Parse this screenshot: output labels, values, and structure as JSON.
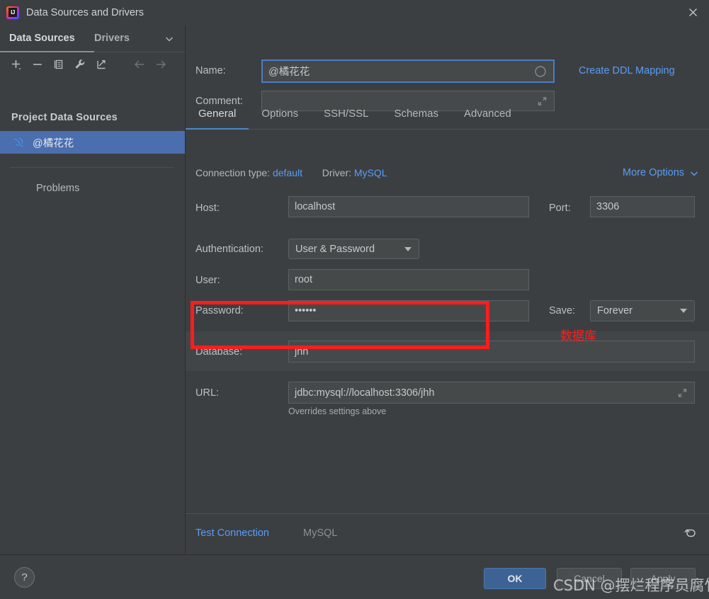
{
  "window": {
    "title": "Data Sources and Drivers",
    "app_icon": "intellij-idea-icon",
    "close_label": "✕"
  },
  "sidebar": {
    "tabs": [
      {
        "label": "Data Sources",
        "active": true
      },
      {
        "label": "Drivers",
        "active": false
      }
    ],
    "chevron": "chevron-down-icon",
    "toolbar": [
      {
        "name": "add-data-source-button",
        "icon": "plus-icon"
      },
      {
        "name": "remove-data-source-button",
        "icon": "minus-icon"
      },
      {
        "name": "duplicate-data-source-button",
        "icon": "copy-icon"
      },
      {
        "name": "driver-properties-button",
        "icon": "wrench-icon"
      },
      {
        "name": "share-data-source-button",
        "icon": "export-arrow-icon"
      },
      {
        "name": "navigate-back-button",
        "icon": "arrow-left-icon"
      },
      {
        "name": "navigate-forward-button",
        "icon": "arrow-right-icon"
      }
    ],
    "section_title": "Project Data Sources",
    "items": [
      {
        "label": "@橘花花",
        "icon": "mysql-dolphin-icon",
        "selected": true
      }
    ],
    "problems_label": "Problems"
  },
  "header": {
    "name_label": "Name:",
    "name_value": "@橘花花",
    "name_adorn_icon": "circle-icon",
    "comment_label": "Comment:",
    "comment_value": "",
    "comment_placeholder": "",
    "comment_expand_icon": "expand-icon",
    "create_ddl_mapping_label": "Create DDL Mapping"
  },
  "tabs": [
    {
      "label": "General",
      "active": true
    },
    {
      "label": "Options",
      "active": false
    },
    {
      "label": "SSH/SSL",
      "active": false
    },
    {
      "label": "Schemas",
      "active": false
    },
    {
      "label": "Advanced",
      "active": false
    }
  ],
  "general": {
    "connection_type_label": "Connection type:",
    "connection_type_value": "default",
    "driver_label": "Driver:",
    "driver_value": "MySQL",
    "more_options_label": "More Options",
    "more_options_icon": "chevron-down-icon",
    "host_label": "Host:",
    "host_value": "localhost",
    "port_label": "Port:",
    "port_value": "3306",
    "authentication_label": "Authentication:",
    "authentication_value": "User & Password",
    "user_label": "User:",
    "user_value": "root",
    "password_label": "Password:",
    "password_value": "••••••",
    "save_label": "Save:",
    "save_value": "Forever",
    "database_label": "Database:",
    "database_value": "jhh",
    "url_label": "URL:",
    "url_value": "jdbc:mysql://localhost:3306/jhh",
    "url_expand_icon": "expand-icon",
    "url_hint": "Overrides settings above"
  },
  "annotation": {
    "highlight_color": "#fe1c1c",
    "text": "数据库"
  },
  "content_footer": {
    "test_connection_label": "Test Connection",
    "driver_name": "MySQL",
    "reset_icon": "undo-arrow-icon"
  },
  "actionbar": {
    "help_label": "?",
    "ok_label": "OK",
    "cancel_label": "Cancel",
    "apply_label": "Apply"
  },
  "watermark": {
    "text": "CSDN @摆烂程序员腐竹"
  }
}
